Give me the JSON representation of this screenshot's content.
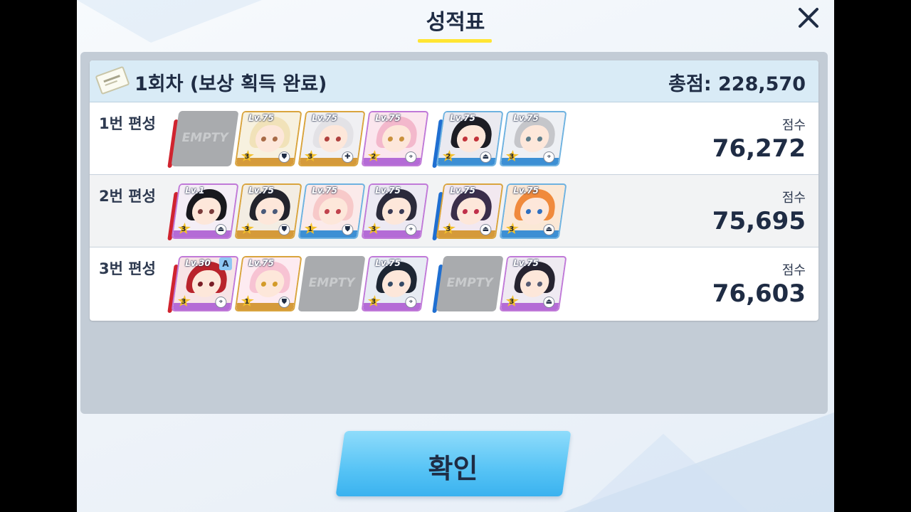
{
  "title": "성적표",
  "round": {
    "label": "1회차 (보상 획득 완료)",
    "total": "총점: 228,570"
  },
  "score_label": "점수",
  "empty_label": "EMPTY",
  "confirm_label": "확인",
  "teams": [
    {
      "label": "1번 편성",
      "score": "76,272",
      "slots": [
        {
          "empty": true
        },
        {
          "level": "Lv.75",
          "star": "3",
          "role_icon": "shield-icon",
          "border": "gold",
          "hair": "#f1e2b9",
          "bg": "#f7f1df",
          "stripe": "#d59a3a",
          "eye": "#a86b47"
        },
        {
          "level": "Lv.75",
          "star": "3",
          "role_icon": "heal-icon",
          "border": "gold",
          "hair": "#e3e2e6",
          "bg": "#f0f0f3",
          "stripe": "#d59a3a",
          "eye": "#b0413e"
        },
        {
          "level": "Lv.75",
          "star": "2",
          "role_icon": "target-icon",
          "border": "purple",
          "hair": "#f3b8cc",
          "bg": "#fbe6ee",
          "stripe": "#b46bd6",
          "eye": "#c9913b"
        },
        {
          "level": "Lv.75",
          "star": "2",
          "role_icon": "support-icon",
          "border": "blue",
          "hair": "#1d1d24",
          "bg": "#eaeaf0",
          "stripe": "#3c8fd4",
          "eye": "#c2323a"
        },
        {
          "level": "Lv.75",
          "star": "3",
          "role_icon": "target-icon",
          "border": "blue",
          "hair": "#c5c6ca",
          "bg": "#eef0f4",
          "stripe": "#3c8fd4",
          "eye": "#5d7c8a"
        }
      ]
    },
    {
      "label": "2번 편성",
      "score": "75,695",
      "slots": [
        {
          "level": "Lv.1",
          "star": "3",
          "role_icon": "support-icon",
          "border": "purple",
          "hair": "#18181d",
          "bg": "#f4eef6",
          "stripe": "#b46bd6",
          "eye": "#7a3b3b"
        },
        {
          "level": "Lv.75",
          "star": "3",
          "role_icon": "shield-icon",
          "border": "gold",
          "hair": "#22232c",
          "bg": "#f3ede3",
          "stripe": "#d59a3a",
          "eye": "#4a5a7a"
        },
        {
          "level": "Lv.75",
          "star": "1",
          "role_icon": "shield-icon",
          "border": "blue",
          "hair": "#f7c9c9",
          "bg": "#fbeaea",
          "stripe": "#3c8fd4",
          "eye": "#c0424c"
        },
        {
          "level": "Lv.75",
          "star": "3",
          "role_icon": "target-icon",
          "border": "purple",
          "hair": "#2b2a3b",
          "bg": "#ece9f3",
          "stripe": "#b46bd6",
          "eye": "#3a3a55"
        },
        {
          "level": "Lv.75",
          "star": "3",
          "role_icon": "support-icon",
          "border": "gold",
          "hair": "#3a2e4a",
          "bg": "#f2e8f0",
          "stripe": "#d59a3a",
          "eye": "#c0304a"
        },
        {
          "level": "Lv.75",
          "star": "3",
          "role_icon": "support-icon",
          "border": "blue",
          "hair": "#f08a3c",
          "bg": "#fbe8d6",
          "stripe": "#3c8fd4",
          "eye": "#2f6fc0"
        }
      ]
    },
    {
      "label": "3번 편성",
      "score": "76,603",
      "slots": [
        {
          "level": "Lv.30",
          "star": "3",
          "role_icon": "target-icon",
          "border": "purple",
          "hair": "#b9232c",
          "bg": "#f7e4e6",
          "stripe": "#b46bd6",
          "eye": "#7a1d26",
          "rank": "A"
        },
        {
          "level": "Lv.75",
          "star": "1",
          "role_icon": "shield-icon",
          "border": "gold",
          "hair": "#f7c3d3",
          "bg": "#fdebf1",
          "stripe": "#d59a3a",
          "eye": "#d39b2a"
        },
        {
          "empty": true
        },
        {
          "level": "Lv.75",
          "star": "3",
          "role_icon": "target-icon",
          "border": "purple",
          "hair": "#1d2633",
          "bg": "#e7ecf3",
          "stripe": "#b46bd6",
          "eye": "#344a66"
        },
        {
          "empty": true
        },
        {
          "level": "Lv.75",
          "star": "3",
          "role_icon": "support-icon",
          "border": "purple",
          "hair": "#262330",
          "bg": "#efeaf2",
          "stripe": "#b46bd6",
          "eye": "#555b73"
        }
      ]
    }
  ]
}
